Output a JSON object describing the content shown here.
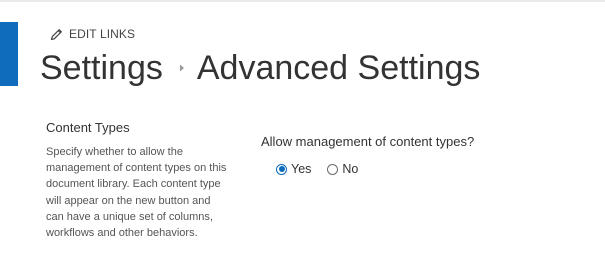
{
  "header": {
    "edit_links_label": "EDIT LINKS",
    "breadcrumb": {
      "parent": "Settings",
      "current": "Advanced Settings"
    }
  },
  "section": {
    "title": "Content Types",
    "description": "Specify whether to allow the management of content types on this document library. Each content type will appear on the new button and can have a unique set of columns, workflows and other behaviors.",
    "question": "Allow management of content types?",
    "options": [
      {
        "label": "Yes",
        "selected": true
      },
      {
        "label": "No",
        "selected": false
      }
    ]
  },
  "colors": {
    "accent": "#0f6cbd"
  },
  "icons": {
    "edit": "pencil-icon",
    "breadcrumb_separator": "chevron-right-icon"
  }
}
